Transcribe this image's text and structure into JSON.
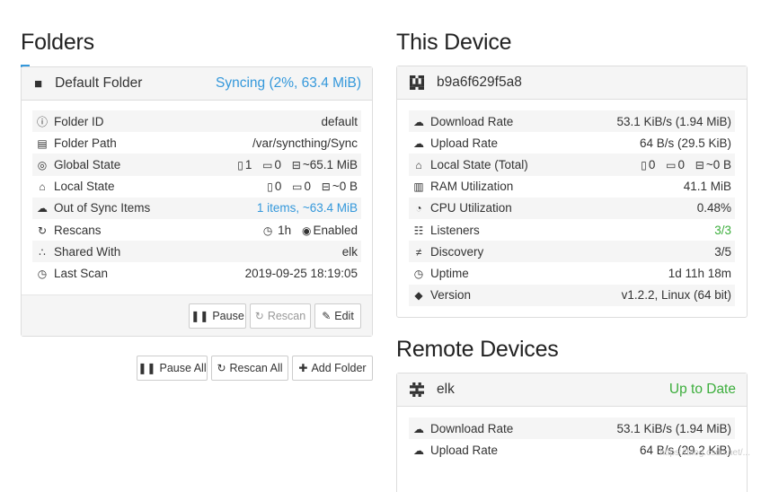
{
  "folders": {
    "title": "Folders",
    "folder": {
      "icon": "folder-icon",
      "name": "Default Folder",
      "status": "Syncing (2%, 63.4 MiB)",
      "status_color": "#3498db",
      "rows": [
        {
          "icon": "info-icon",
          "label": "Folder ID",
          "value": "default"
        },
        {
          "icon": "folder-open-icon",
          "label": "Folder Path",
          "value": "/var/syncthing/Sync"
        },
        {
          "icon": "globe-icon",
          "label": "Global State",
          "files": "1",
          "dirs": "0",
          "size": "~65.1 MiB"
        },
        {
          "icon": "home-icon",
          "label": "Local State",
          "files": "0",
          "dirs": "0",
          "size": "~0 B"
        },
        {
          "icon": "cloud-icon",
          "label": "Out of Sync Items",
          "value": "1 items, ~63.4 MiB"
        },
        {
          "icon": "refresh-icon",
          "label": "Rescans",
          "interval": "1h",
          "watch": "Enabled"
        },
        {
          "icon": "share-icon",
          "label": "Shared With",
          "value": "elk"
        },
        {
          "icon": "clock-icon",
          "label": "Last Scan",
          "value": "2019-09-25 18:19:05"
        }
      ],
      "buttons": {
        "pause": "Pause",
        "rescan": "Rescan",
        "edit": "Edit"
      }
    },
    "actions": {
      "pause_all": "Pause All",
      "rescan_all": "Rescan All",
      "add_folder": "Add Folder"
    }
  },
  "this_device": {
    "title": "This Device",
    "name": "b9a6f629f5a8",
    "icon": "identicon-icon",
    "rows": [
      {
        "icon": "cloud-download-icon",
        "label": "Download Rate",
        "value": "53.1 KiB/s (1.94 MiB)"
      },
      {
        "icon": "cloud-upload-icon",
        "label": "Upload Rate",
        "value": "64 B/s (29.5 KiB)"
      },
      {
        "icon": "home-icon",
        "label": "Local State (Total)",
        "files": "0",
        "dirs": "0",
        "size": "~0 B"
      },
      {
        "icon": "memory-icon",
        "label": "RAM Utilization",
        "value": "41.1 MiB"
      },
      {
        "icon": "dashboard-icon",
        "label": "CPU Utilization",
        "value": "0.48%"
      },
      {
        "icon": "sitemap-icon",
        "label": "Listeners",
        "value": "3/3",
        "color": "#3cae3c"
      },
      {
        "icon": "signpost-icon",
        "label": "Discovery",
        "value": "3/5"
      },
      {
        "icon": "clock-icon",
        "label": "Uptime",
        "value": "1d 11h 18m"
      },
      {
        "icon": "tag-icon",
        "label": "Version",
        "value": "v1.2.2, Linux (64 bit)"
      }
    ]
  },
  "remote_devices": {
    "title": "Remote Devices",
    "device": {
      "name": "elk",
      "icon": "identicon-icon",
      "status": "Up to Date",
      "status_color": "#3cae3c",
      "rows": [
        {
          "icon": "cloud-download-icon",
          "label": "Download Rate",
          "value": "53.1 KiB/s (1.94 MiB)"
        },
        {
          "icon": "cloud-upload-icon",
          "label": "Upload Rate",
          "value": "64 B/s (29.2 KiB)"
        }
      ]
    }
  },
  "watermark": "https://blog.csdn.net/..."
}
